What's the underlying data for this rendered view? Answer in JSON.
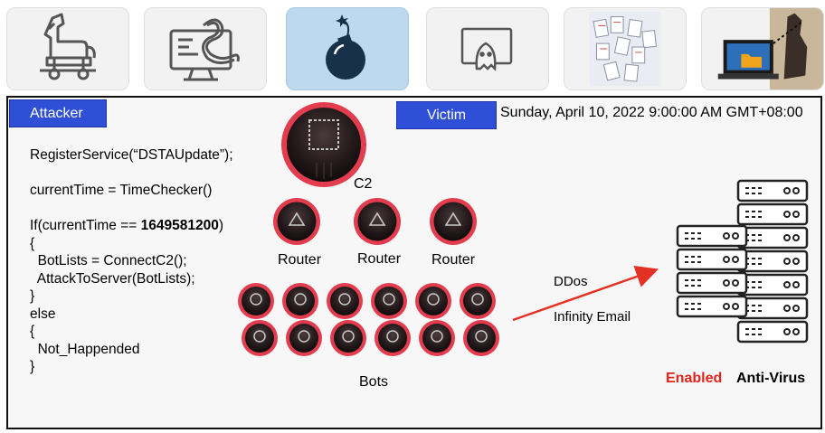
{
  "toolbar": {
    "tiles": [
      {
        "icon": "trojan-horse-icon"
      },
      {
        "icon": "computer-worm-icon"
      },
      {
        "icon": "bomb-icon",
        "active": true
      },
      {
        "icon": "ghost-screen-icon"
      },
      {
        "icon": "documents-pile-icon"
      },
      {
        "icon": "hacker-laptop-icon"
      }
    ]
  },
  "slide": {
    "attacker_label": "Attacker",
    "victim_label": "Victim",
    "datetime": "Sunday, April 10, 2022 9:00:00 AM GMT+08:00",
    "code": {
      "line1": "RegisterService(“DSTAUpdate”);",
      "line2": "currentTime = TimeChecker()",
      "line3_prefix": "If(currentTime == ",
      "line3_value": "1649581200",
      "line3_suffix": ")",
      "line4": "{",
      "line5": "  BotLists = ConnectC2();",
      "line6": "  AttackToServer(BotLists);",
      "line7": "}",
      "line8": "else",
      "line9": "{",
      "line10": "  Not_Happended",
      "line11": "}"
    },
    "c2_label": "C2",
    "router_labels": [
      "Router",
      "Router",
      "Router"
    ],
    "bots_label": "Bots",
    "bot_count": 12,
    "attack_types": [
      "DDos",
      "Infinity Email"
    ],
    "enabled_label": "Enabled",
    "antivirus_label": "Anti-Virus",
    "colors": {
      "tag_blue": "#2f4fd6",
      "enabled_red": "#e0231b",
      "node_ring": "#e23c4e",
      "arrow": "#e33124",
      "active_tile": "#bcd9ef"
    }
  }
}
